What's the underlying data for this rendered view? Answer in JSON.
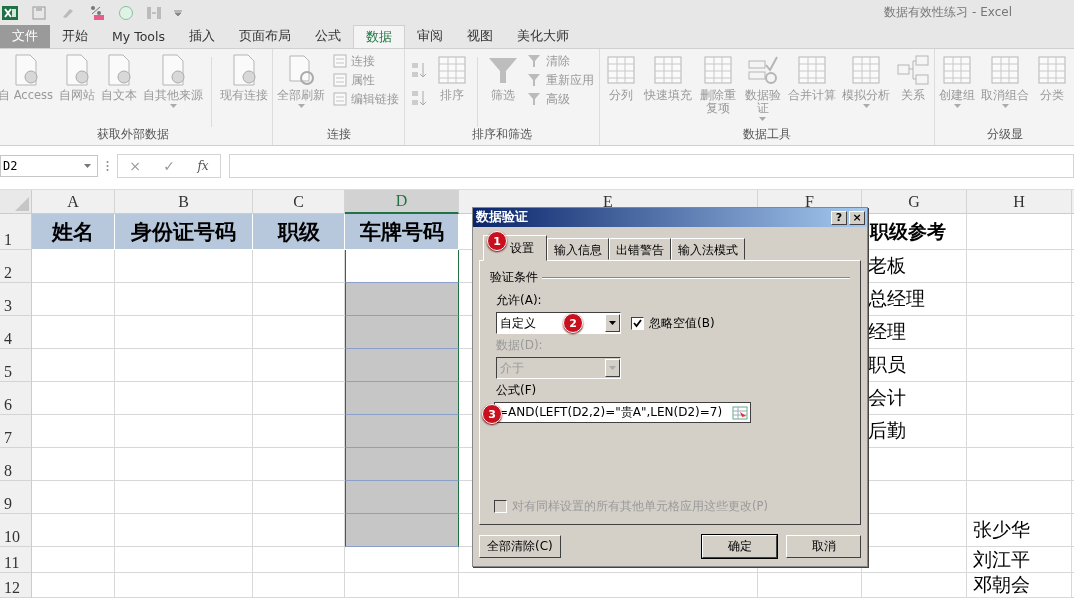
{
  "window": {
    "title": "数据有效性练习 - Excel"
  },
  "ribbon": {
    "tabs": [
      {
        "label": "文件",
        "selected": false,
        "kind": "file"
      },
      {
        "label": "开始",
        "selected": false,
        "kind": "tab"
      },
      {
        "label": "My Tools",
        "selected": false,
        "kind": "tab"
      },
      {
        "label": "插入",
        "selected": false,
        "kind": "tab"
      },
      {
        "label": "页面布局",
        "selected": false,
        "kind": "tab"
      },
      {
        "label": "公式",
        "selected": false,
        "kind": "tab"
      },
      {
        "label": "数据",
        "selected": true,
        "kind": "tab"
      },
      {
        "label": "审阅",
        "selected": false,
        "kind": "tab"
      },
      {
        "label": "视图",
        "selected": false,
        "kind": "tab"
      },
      {
        "label": "美化大师",
        "selected": false,
        "kind": "tab"
      }
    ],
    "groups": [
      {
        "label": "获取外部数据",
        "items": [
          {
            "kind": "large",
            "label": "自 Access",
            "dropdown": false
          },
          {
            "kind": "large",
            "label": "自网站",
            "dropdown": false
          },
          {
            "kind": "large",
            "label": "自文本",
            "dropdown": false
          },
          {
            "kind": "large",
            "label": "自其他来源",
            "dropdown": true
          },
          {
            "kind": "divider"
          },
          {
            "kind": "large",
            "label": "现有连接",
            "dropdown": false
          }
        ]
      },
      {
        "label": "连接",
        "items": [
          {
            "kind": "large",
            "label": "全部刷新",
            "dropdown": true
          },
          {
            "kind": "small",
            "labels": [
              "连接",
              "属性",
              "编辑链接"
            ]
          }
        ]
      },
      {
        "label": "排序和筛选",
        "items": [
          {
            "kind": "sort"
          },
          {
            "kind": "large",
            "label": "排序",
            "dropdown": false
          },
          {
            "kind": "divider"
          },
          {
            "kind": "large",
            "label": "筛选",
            "dropdown": false
          },
          {
            "kind": "small",
            "labels": [
              "清除",
              "重新应用",
              "高级"
            ]
          }
        ]
      },
      {
        "label": "数据工具",
        "items": [
          {
            "kind": "large",
            "label": "分列",
            "dropdown": false
          },
          {
            "kind": "large",
            "label": "快速填充",
            "dropdown": false
          },
          {
            "kind": "large",
            "label": "删除重复项",
            "dropdown": false,
            "wrapped": true
          },
          {
            "kind": "large",
            "label": "数据验证",
            "dropdown": true,
            "wrapped": true
          },
          {
            "kind": "large",
            "label": "合并计算",
            "dropdown": false
          },
          {
            "kind": "large",
            "label": "模拟分析",
            "dropdown": true
          },
          {
            "kind": "large",
            "label": "关系",
            "dropdown": false
          }
        ]
      },
      {
        "label": "分级显",
        "items": [
          {
            "kind": "large",
            "label": "创建组",
            "dropdown": true
          },
          {
            "kind": "large",
            "label": "取消组合",
            "dropdown": true
          },
          {
            "kind": "large",
            "label": "分类",
            "dropdown": false
          }
        ]
      }
    ]
  },
  "formula_bar": {
    "name_box": "D2",
    "cancel": "×",
    "enter": "✓",
    "function": "fx"
  },
  "sheet": {
    "columns": [
      {
        "letter": "A",
        "selected": false
      },
      {
        "letter": "B",
        "selected": false
      },
      {
        "letter": "C",
        "selected": false
      },
      {
        "letter": "D",
        "selected": true
      },
      {
        "letter": "E",
        "selected": false
      },
      {
        "letter": "F",
        "selected": false
      },
      {
        "letter": "G",
        "selected": false
      },
      {
        "letter": "H",
        "selected": false
      }
    ],
    "rows": [
      {
        "number": "1",
        "selected": false,
        "cells": [
          "姓名",
          "身份证号码",
          "职级",
          "车牌号码",
          "",
          "",
          "职级参考",
          ""
        ]
      },
      {
        "number": "2",
        "selected": true,
        "cells": [
          "",
          "",
          "",
          "",
          "",
          "",
          "老板",
          ""
        ]
      },
      {
        "number": "3",
        "selected": true,
        "cells": [
          "",
          "",
          "",
          "",
          "",
          "",
          "总经理",
          ""
        ]
      },
      {
        "number": "4",
        "selected": true,
        "cells": [
          "",
          "",
          "",
          "",
          "",
          "",
          "经理",
          ""
        ]
      },
      {
        "number": "5",
        "selected": true,
        "cells": [
          "",
          "",
          "",
          "",
          "",
          "",
          "职员",
          ""
        ]
      },
      {
        "number": "6",
        "selected": true,
        "cells": [
          "",
          "",
          "",
          "",
          "",
          "",
          "会计",
          ""
        ]
      },
      {
        "number": "7",
        "selected": true,
        "cells": [
          "",
          "",
          "",
          "",
          "",
          "",
          "后勤",
          ""
        ]
      },
      {
        "number": "8",
        "selected": true,
        "cells": [
          "",
          "",
          "",
          "",
          "",
          "",
          "",
          ""
        ]
      },
      {
        "number": "9",
        "selected": true,
        "cells": [
          "",
          "",
          "",
          "",
          "",
          "",
          "",
          ""
        ]
      },
      {
        "number": "10",
        "selected": true,
        "cells": [
          "",
          "",
          "",
          "",
          "",
          "",
          "",
          "张少华"
        ]
      },
      {
        "number": "11",
        "selected": false,
        "cells": [
          "",
          "",
          "",
          "",
          "",
          "",
          "",
          "刘江平"
        ]
      },
      {
        "number": "12",
        "selected": false,
        "cells": [
          "",
          "",
          "",
          "",
          "",
          "",
          "",
          "邓朝会"
        ]
      }
    ]
  },
  "dialog": {
    "title": "数据验证",
    "help": "?",
    "close": "×",
    "tabs": [
      {
        "label": "设置",
        "selected": true,
        "badge": "1"
      },
      {
        "label": "输入信息",
        "selected": false
      },
      {
        "label": "出错警告",
        "selected": false
      },
      {
        "label": "输入法模式",
        "selected": false
      }
    ],
    "section": "验证条件",
    "allow": {
      "label": "允许(A):",
      "value": "自定义",
      "badge": "2"
    },
    "ignore_blank": {
      "label": "忽略空值(B)",
      "checked": true
    },
    "data": {
      "label": "数据(D):",
      "value": "介于",
      "disabled": true
    },
    "formula": {
      "label": "公式(F)",
      "value": "=AND(LEFT(D2,2)=\"贵A\",LEN(D2)=7)",
      "badge": "3"
    },
    "apply_all": {
      "label": "对有同样设置的所有其他单元格应用这些更改(P)",
      "checked": false,
      "disabled": true
    },
    "buttons": [
      {
        "label": "全部清除(C)",
        "default": false
      },
      {
        "label": "确定",
        "default": true
      },
      {
        "label": "取消",
        "default": false
      }
    ]
  }
}
